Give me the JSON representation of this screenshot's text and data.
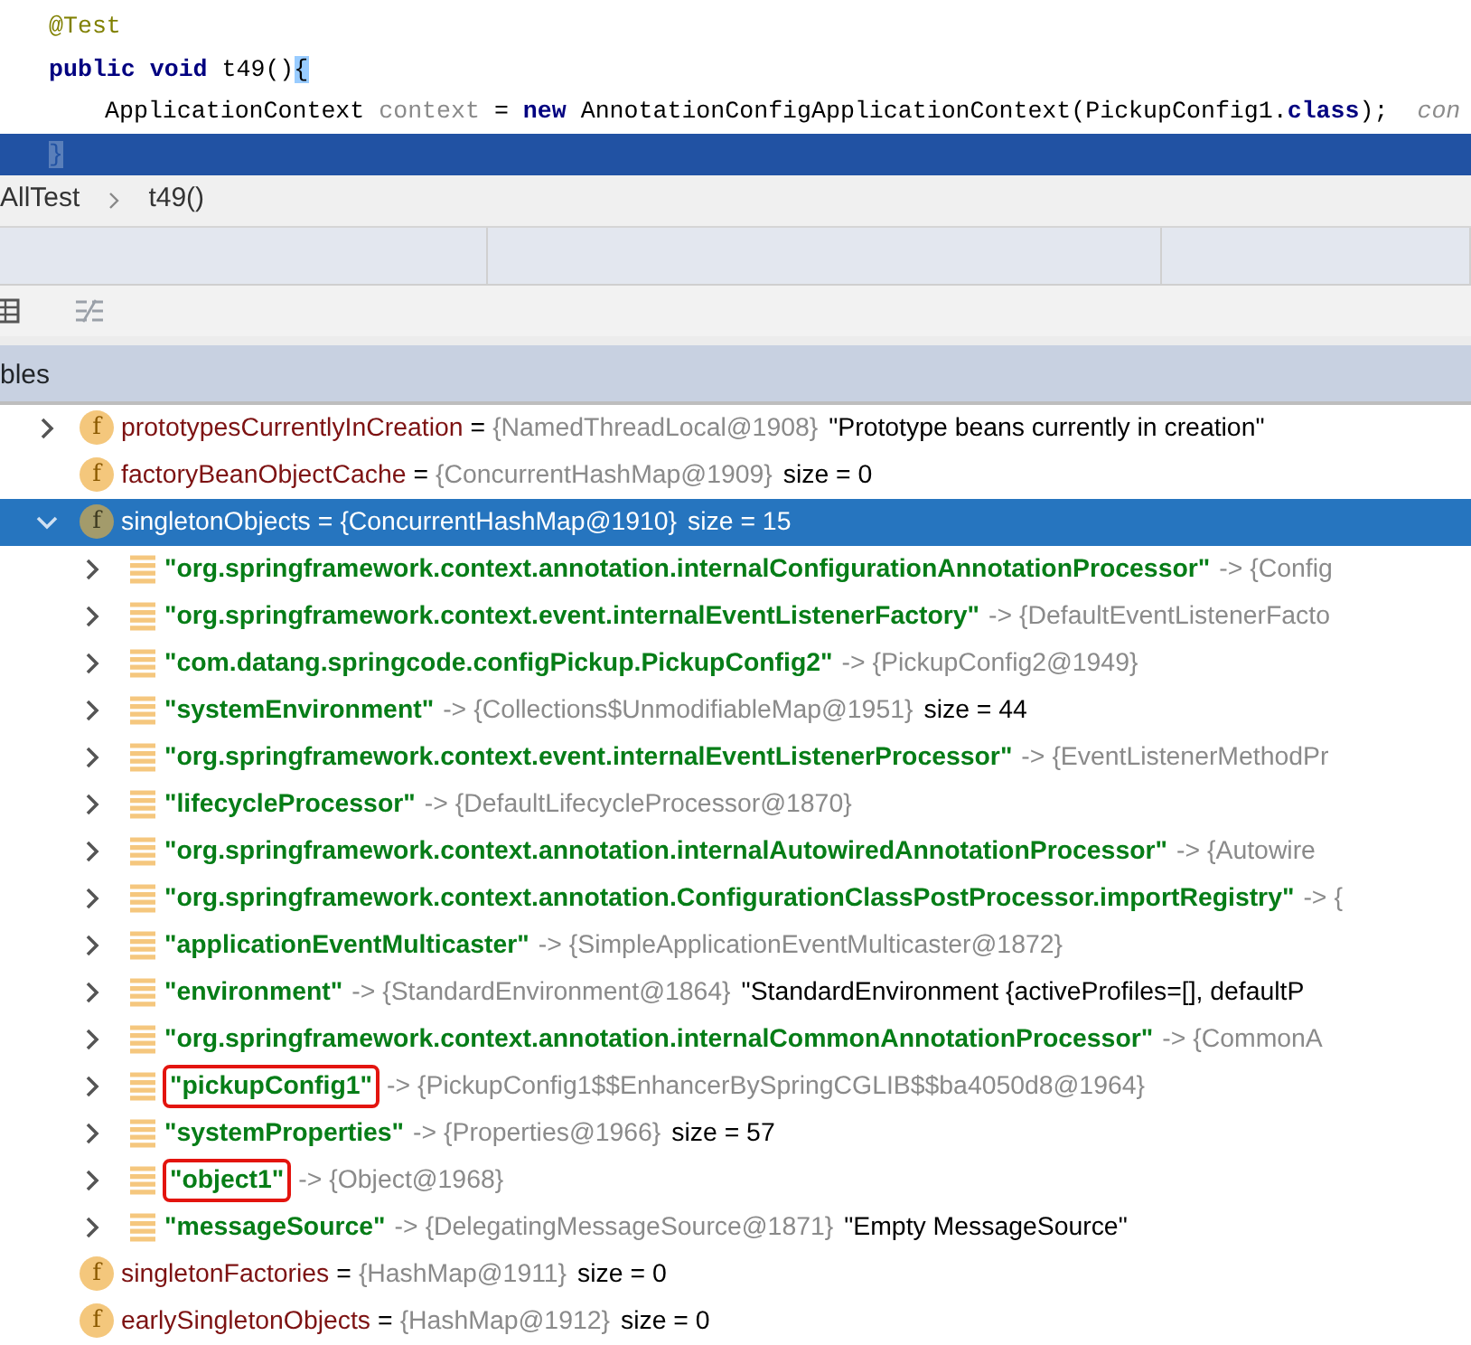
{
  "editor": {
    "lines": [
      {
        "kind": "top",
        "current": false,
        "tokens": [
          {
            "kind": "annotation",
            "text": "@Test"
          }
        ]
      },
      {
        "kind": "top",
        "current": false,
        "tokens": [
          {
            "kind": "keyword",
            "text": "public void "
          },
          {
            "kind": "plain",
            "text": "t49()"
          },
          {
            "kind": "match",
            "text": "{"
          }
        ]
      },
      {
        "kind": "body",
        "current": false,
        "tokens": [
          {
            "kind": "plain",
            "text": "ApplicationContext "
          },
          {
            "kind": "var",
            "text": "context"
          },
          {
            "kind": "plain",
            "text": " = "
          },
          {
            "kind": "keyword",
            "text": "new "
          },
          {
            "kind": "plain",
            "text": "AnnotationConfigApplicationContext(PickupConfig1."
          },
          {
            "kind": "keyword",
            "text": "class"
          },
          {
            "kind": "plain",
            "text": ");"
          },
          {
            "kind": "hint",
            "text": "con"
          }
        ]
      },
      {
        "kind": "top",
        "current": true,
        "tokens": [
          {
            "kind": "match",
            "text": "}"
          }
        ]
      }
    ]
  },
  "breadcrumb": [
    "AllTest",
    "t49()"
  ],
  "panel": {
    "title": "bles"
  },
  "tree": [
    {
      "name": "prototypesCurrentlyInCreation",
      "badge": "f",
      "sep": "=",
      "value": "{NamedThreadLocal@1908}",
      "extra": "\"Prototype beans currently in creation\"",
      "expanded": false,
      "selected": false
    },
    {
      "name": "factoryBeanObjectCache",
      "badge": "f",
      "sep": "=",
      "value": "{ConcurrentHashMap@1909}",
      "extra": "size = 0",
      "selected": false
    },
    {
      "name": "singletonObjects",
      "badge": "f",
      "sep": "=",
      "value": "{ConcurrentHashMap@1910}",
      "extra": "size = 15",
      "expanded": true,
      "selected": true,
      "children": [
        {
          "key": "\"org.springframework.context.annotation.internalConfigurationAnnotationProcessor\"",
          "sep": "->",
          "value": "{Config",
          "expanded": false,
          "highlighted": false
        },
        {
          "key": "\"org.springframework.context.event.internalEventListenerFactory\"",
          "sep": "->",
          "value": "{DefaultEventListenerFacto",
          "expanded": false,
          "highlighted": false
        },
        {
          "key": "\"com.datang.springcode.configPickup.PickupConfig2\"",
          "sep": "->",
          "value": "{PickupConfig2@1949}",
          "expanded": false,
          "highlighted": false
        },
        {
          "key": "\"systemEnvironment\"",
          "sep": "->",
          "value": "{Collections$UnmodifiableMap@1951}",
          "extra": "size = 44",
          "expanded": false,
          "highlighted": false
        },
        {
          "key": "\"org.springframework.context.event.internalEventListenerProcessor\"",
          "sep": "->",
          "value": "{EventListenerMethodPr",
          "expanded": false,
          "highlighted": false
        },
        {
          "key": "\"lifecycleProcessor\"",
          "sep": "->",
          "value": "{DefaultLifecycleProcessor@1870}",
          "expanded": false,
          "highlighted": false
        },
        {
          "key": "\"org.springframework.context.annotation.internalAutowiredAnnotationProcessor\"",
          "sep": "->",
          "value": "{Autowire",
          "expanded": false,
          "highlighted": false
        },
        {
          "key": "\"org.springframework.context.annotation.ConfigurationClassPostProcessor.importRegistry\"",
          "sep": "->",
          "value": "{",
          "expanded": false,
          "highlighted": false
        },
        {
          "key": "\"applicationEventMulticaster\"",
          "sep": "->",
          "value": "{SimpleApplicationEventMulticaster@1872}",
          "expanded": false,
          "highlighted": false
        },
        {
          "key": "\"environment\"",
          "sep": "->",
          "value": "{StandardEnvironment@1864}",
          "extra": "\"StandardEnvironment {activeProfiles=[], defaultP",
          "expanded": false,
          "highlighted": false
        },
        {
          "key": "\"org.springframework.context.annotation.internalCommonAnnotationProcessor\"",
          "sep": "->",
          "value": "{CommonA",
          "expanded": false,
          "highlighted": false
        },
        {
          "key": "\"pickupConfig1\"",
          "sep": "->",
          "value": "{PickupConfig1$$EnhancerBySpringCGLIB$$ba4050d8@1964}",
          "expanded": false,
          "highlighted": true
        },
        {
          "key": "\"systemProperties\"",
          "sep": "->",
          "value": "{Properties@1966}",
          "extra": "size = 57",
          "expanded": false,
          "highlighted": false
        },
        {
          "key": "\"object1\"",
          "sep": "->",
          "value": "{Object@1968}",
          "expanded": false,
          "highlighted": true
        },
        {
          "key": "\"messageSource\"",
          "sep": "->",
          "value": "{DelegatingMessageSource@1871}",
          "extra": "\"Empty MessageSource\"",
          "expanded": false,
          "highlighted": false
        }
      ]
    },
    {
      "name": "singletonFactories",
      "badge": "f",
      "sep": "=",
      "value": "{HashMap@1911}",
      "extra": "size = 0",
      "selected": false
    },
    {
      "name": "earlySingletonObjects",
      "badge": "f",
      "sep": "=",
      "value": "{HashMap@1912}",
      "extra": "size = 0",
      "selected": false
    }
  ]
}
